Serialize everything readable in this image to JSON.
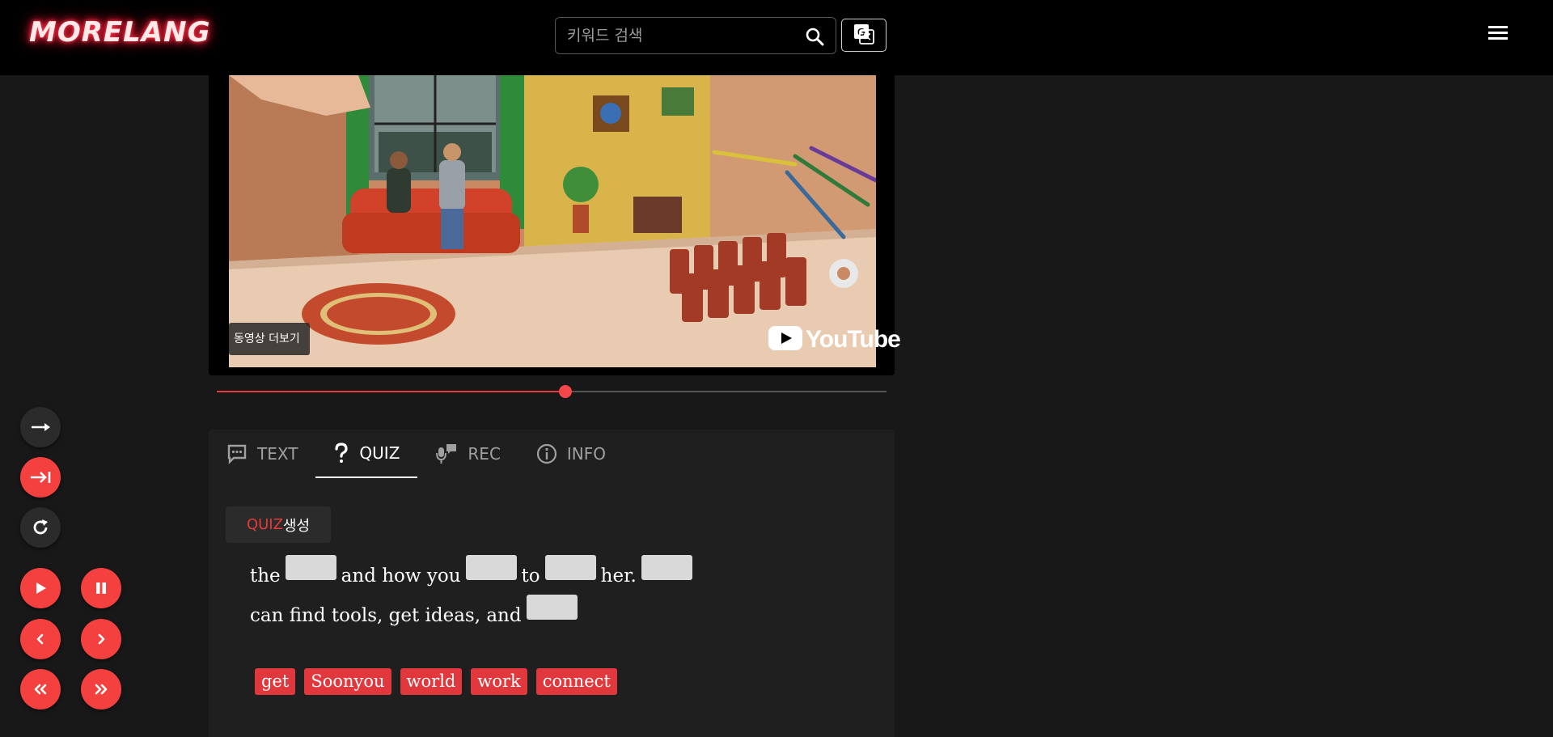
{
  "header": {
    "logo": "MORELANG",
    "search_placeholder": "키워드 검색",
    "search_icon": "search-icon",
    "translate_icon": "google-translate-icon",
    "menu_icon": "hamburger-menu-icon"
  },
  "video": {
    "more_videos_label": "동영상 더보기",
    "youtube_label": "YouTube",
    "progress_fraction": 0.52
  },
  "tabs": [
    {
      "label": "TEXT",
      "icon": "text-comment-icon"
    },
    {
      "label": "QUIZ",
      "icon": "question-mark-icon"
    },
    {
      "label": "REC",
      "icon": "record-mic-icon"
    },
    {
      "label": "INFO",
      "icon": "info-icon"
    }
  ],
  "active_tab": "QUIZ",
  "quiz": {
    "button_red": "QUIZ",
    "button_white": "생성",
    "line1": {
      "w1": "the",
      "w2": "and how you",
      "w3": "to",
      "w4": "her."
    },
    "line2": {
      "w1": "can find tools, get ideas, and"
    },
    "choices": [
      "get",
      "Soonyou",
      "world",
      "work",
      "connect"
    ]
  },
  "colors": {
    "accent_red": "#f4413f",
    "background": "#181818",
    "panel": "#1f1f1f"
  }
}
